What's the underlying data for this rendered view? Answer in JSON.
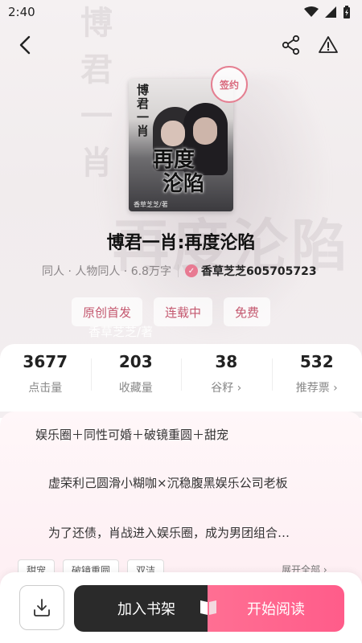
{
  "status_bar": {
    "time": "2:40"
  },
  "cover": {
    "vertical_title": "博君一肖",
    "title_line1": "再度",
    "title_line2": "沦陷",
    "author_credit": "香草芝芝/著",
    "badge": "签约"
  },
  "background": {
    "chars": [
      "博",
      "君",
      "一",
      "肖"
    ],
    "big_text": "再度沦陷",
    "author_credit": "香草芝芝/著"
  },
  "book": {
    "title": "博君一肖:再度沦陷",
    "category": "同人 · 人物同人 · 6.8万字",
    "author": "香草芝芝605705723"
  },
  "tags": [
    "原创首发",
    "连载中",
    "免费"
  ],
  "stats": [
    {
      "value": "3677",
      "label": "点击量"
    },
    {
      "value": "203",
      "label": "收藏量"
    },
    {
      "value": "38",
      "label": "谷籽",
      "arrow": "›"
    },
    {
      "value": "532",
      "label": "推荐票",
      "arrow": "›"
    }
  ],
  "description": {
    "line1": "娱乐圈＋同性可婚＋破镜重圆＋甜宠",
    "line2": "虚荣利己圆滑小糊咖×沉稳腹黑娱乐公司老板",
    "line3": "为了还债，肖战进入娱乐圈，成为男团组合…"
  },
  "small_tags": [
    "甜宠",
    "破镜重圆",
    "双洁"
  ],
  "expand_all": "展开全部 ›",
  "bottom": {
    "add_shelf": "加入书架",
    "start_read": "开始阅读"
  }
}
